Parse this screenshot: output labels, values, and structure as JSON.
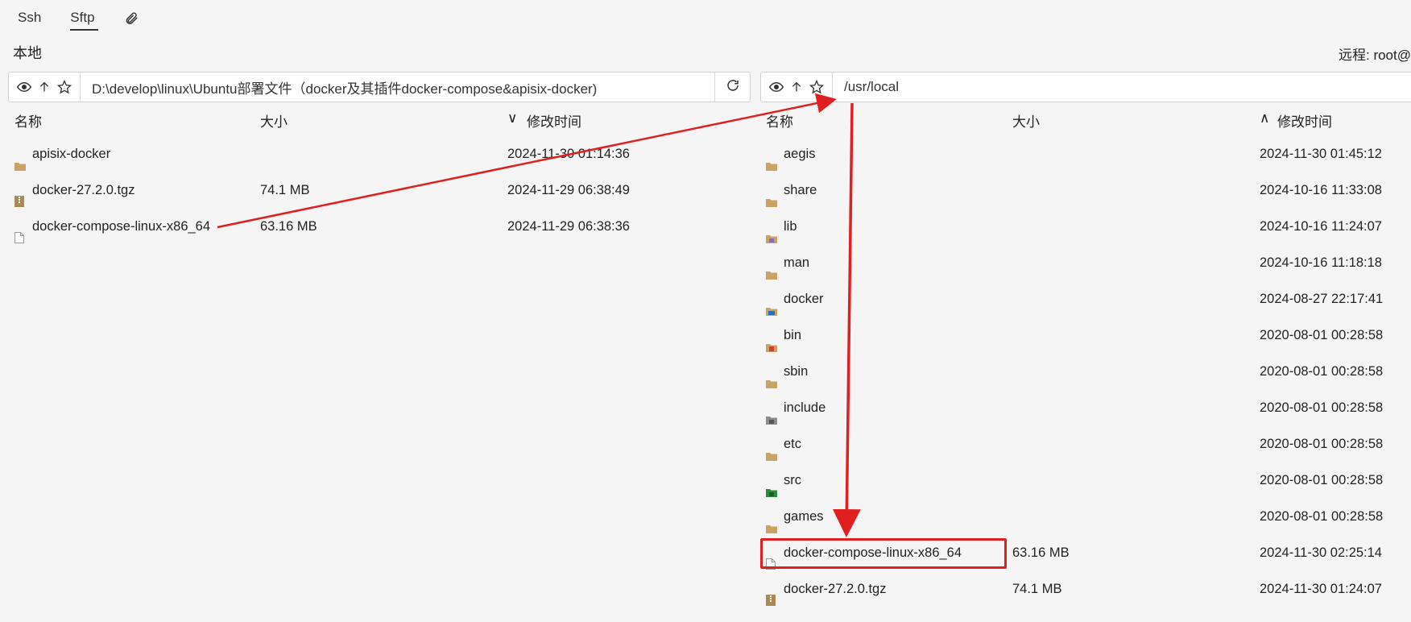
{
  "tabs": [
    {
      "label": "Ssh",
      "active": false
    },
    {
      "label": "Sftp",
      "active": true
    }
  ],
  "local": {
    "title": "本地",
    "path": "D:\\develop\\linux\\Ubuntu部署文件（docker及其插件docker-compose&apisix-docker)",
    "columns": {
      "name": "名称",
      "size": "大小",
      "modified": "修改时间"
    },
    "sort_indicator": "∨",
    "files": [
      {
        "name": "apisix-docker",
        "size": "",
        "modified": "2024-11-30 01:14:36",
        "icon": "folder-icon"
      },
      {
        "name": "docker-27.2.0.tgz",
        "size": "74.1 MB",
        "modified": "2024-11-29 06:38:49",
        "icon": "archive-icon"
      },
      {
        "name": "docker-compose-linux-x86_64",
        "size": "63.16 MB",
        "modified": "2024-11-29 06:38:36",
        "icon": "file-icon"
      }
    ]
  },
  "remote": {
    "title": "远程: root@",
    "path": "/usr/local",
    "columns": {
      "name": "名称",
      "size": "大小",
      "modified": "修改时间"
    },
    "sort_indicator": "∧",
    "files": [
      {
        "name": "aegis",
        "size": "",
        "modified": "2024-11-30 01:45:12",
        "icon": "folder-icon"
      },
      {
        "name": "share",
        "size": "",
        "modified": "2024-10-16 11:33:08",
        "icon": "folder-icon"
      },
      {
        "name": "lib",
        "size": "",
        "modified": "2024-10-16 11:24:07",
        "icon": "folder-lib-icon"
      },
      {
        "name": "man",
        "size": "",
        "modified": "2024-10-16 11:18:18",
        "icon": "folder-icon"
      },
      {
        "name": "docker",
        "size": "",
        "modified": "2024-08-27 22:17:41",
        "icon": "folder-docker-icon"
      },
      {
        "name": "bin",
        "size": "",
        "modified": "2020-08-01 00:28:58",
        "icon": "folder-bin-icon"
      },
      {
        "name": "sbin",
        "size": "",
        "modified": "2020-08-01 00:28:58",
        "icon": "folder-icon"
      },
      {
        "name": "include",
        "size": "",
        "modified": "2020-08-01 00:28:58",
        "icon": "folder-include-icon"
      },
      {
        "name": "etc",
        "size": "",
        "modified": "2020-08-01 00:28:58",
        "icon": "folder-icon"
      },
      {
        "name": "src",
        "size": "",
        "modified": "2020-08-01 00:28:58",
        "icon": "folder-src-icon"
      },
      {
        "name": "games",
        "size": "",
        "modified": "2020-08-01 00:28:58",
        "icon": "folder-icon"
      },
      {
        "name": "docker-compose-linux-x86_64",
        "size": "63.16 MB",
        "modified": "2024-11-30 02:25:14",
        "icon": "file-icon"
      },
      {
        "name": "docker-27.2.0.tgz",
        "size": "74.1 MB",
        "modified": "2024-11-30 01:24:07",
        "icon": "archive-icon"
      }
    ]
  },
  "colors": {
    "annotation": "#e02020",
    "folder": "#c9a266",
    "archive": "#a88a57"
  }
}
